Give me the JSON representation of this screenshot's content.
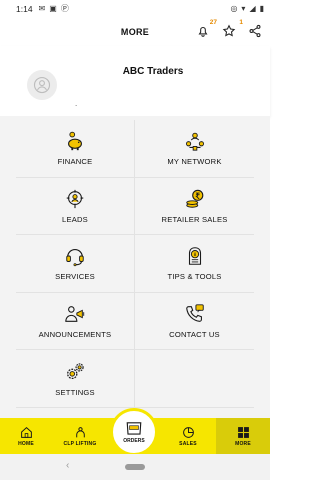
{
  "status_bar": {
    "time": "1:14"
  },
  "header": {
    "title": "MORE",
    "notifications_count": "27",
    "favorites_count": "1"
  },
  "profile": {
    "name": "ABC Traders",
    "subtitle": "."
  },
  "menu": [
    {
      "label": "FINANCE",
      "icon": "piggy-bank-icon"
    },
    {
      "label": "MY NETWORK",
      "icon": "network-icon"
    },
    {
      "label": "LEADS",
      "icon": "leads-target-icon"
    },
    {
      "label": "RETAILER SALES",
      "icon": "rupee-coins-icon"
    },
    {
      "label": "SERVICES",
      "icon": "headset-icon"
    },
    {
      "label": "TIPS & TOOLS",
      "icon": "info-document-icon"
    },
    {
      "label": "ANNOUNCEMENTS",
      "icon": "megaphone-person-icon"
    },
    {
      "label": "CONTACT US",
      "icon": "phone-icon"
    },
    {
      "label": "SETTINGS",
      "icon": "gears-icon"
    }
  ],
  "bottom_nav": {
    "home": "HOME",
    "clp_lifting": "CLP LIFTING",
    "orders": "ORDERS",
    "sales": "SALES",
    "more": "MORE"
  },
  "colors": {
    "accent_yellow": "#f6e600",
    "icon_yellow": "#f2c200",
    "icon_outline": "#1a1a1a"
  }
}
